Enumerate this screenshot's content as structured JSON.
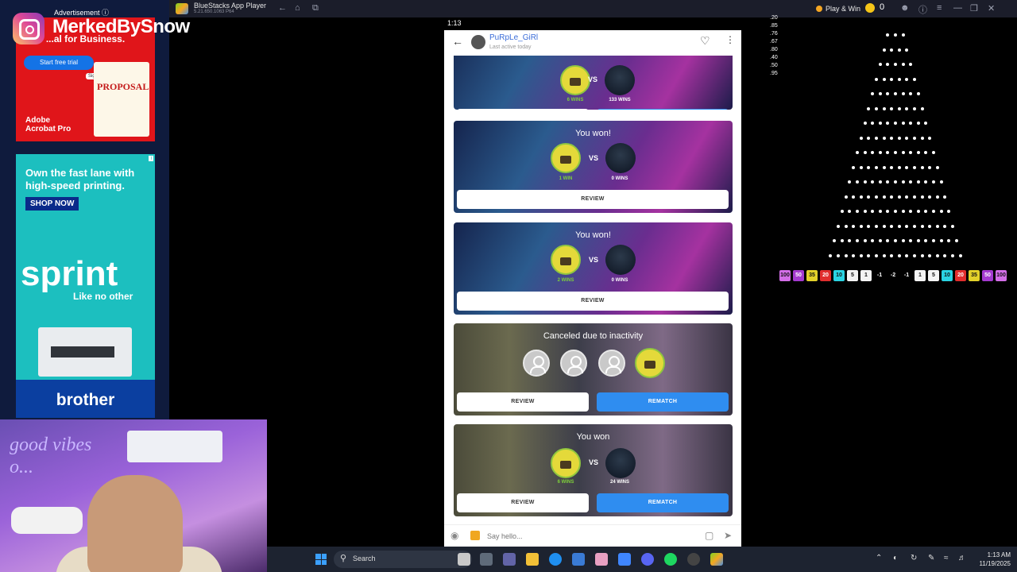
{
  "bluestacks": {
    "title": "BlueStacks App Player",
    "version": "5.21.650.1063  P64",
    "play_win": "Play & Win",
    "coins": "0"
  },
  "ads": {
    "label": "Advertisement ⓘ",
    "adobe": {
      "headline": "...al for Business.",
      "cta": "Start free trial",
      "doc_title": "PROPOSAL",
      "sign_tag": "Sign",
      "brand": "Adobe\nAcrobat Pro"
    },
    "brother": {
      "headline": "Own the fast lane with high-speed printing.",
      "cta": "SHOP NOW",
      "product": "sprint",
      "tagline": "Like no other",
      "brand": "brother"
    }
  },
  "stream": {
    "handle": "MerkedBySnow",
    "neon_sign": "good vibes o..."
  },
  "phone": {
    "status_time": "1:13",
    "contact_name": "PuRpLe_GiRl",
    "contact_status": "Last active today",
    "input_placeholder": "Say hello...",
    "vs": "VS",
    "review": "REVIEW",
    "rematch": "REMATCH",
    "cards": [
      {
        "title": "",
        "left_wins": "6 WINS",
        "right_wins": "133 WINS"
      },
      {
        "title": "You won!",
        "left_wins": "1 WIN",
        "right_wins": "0 WINS"
      },
      {
        "title": "You won!",
        "left_wins": "2 WINS",
        "right_wins": "0 WINS"
      },
      {
        "title": "Canceled due to inactivity"
      },
      {
        "title": "You won",
        "left_wins": "6 WINS",
        "right_wins": "24 WINS"
      }
    ]
  },
  "plinko": {
    "history": [
      ".20",
      ".85",
      ".76",
      ".67",
      ".80",
      ".40",
      ".50",
      ".95"
    ],
    "slots": [
      {
        "v": "100",
        "c": "#d36ee8"
      },
      {
        "v": "50",
        "c": "#a43ad0"
      },
      {
        "v": "35",
        "c": "#e3d12a"
      },
      {
        "v": "20",
        "c": "#e12d2d"
      },
      {
        "v": "10",
        "c": "#2ad3e3"
      },
      {
        "v": "5",
        "c": "#f4f4f4"
      },
      {
        "v": "1",
        "c": "#f4f4f4"
      },
      {
        "v": "-1",
        "c": "#000000"
      },
      {
        "v": "-2",
        "c": "#000000"
      },
      {
        "v": "-1",
        "c": "#000000"
      },
      {
        "v": "1",
        "c": "#f4f4f4"
      },
      {
        "v": "5",
        "c": "#f4f4f4"
      },
      {
        "v": "10",
        "c": "#2ad3e3"
      },
      {
        "v": "20",
        "c": "#e12d2d"
      },
      {
        "v": "35",
        "c": "#e3d12a"
      },
      {
        "v": "50",
        "c": "#a43ad0"
      },
      {
        "v": "100",
        "c": "#d36ee8"
      }
    ]
  },
  "taskbar": {
    "search": "Search",
    "time": "1:13 AM",
    "date": "11/19/2025"
  }
}
